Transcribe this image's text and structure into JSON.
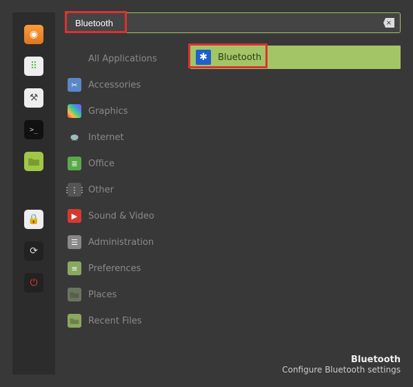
{
  "search": {
    "value": "Bluetooth"
  },
  "favorites": [
    {
      "id": "firefox",
      "glyph": "◉"
    },
    {
      "id": "apps",
      "glyph": "⠿"
    },
    {
      "id": "settings",
      "glyph": "⚒"
    },
    {
      "id": "terminal",
      "glyph": ">_"
    },
    {
      "id": "files",
      "glyph": ""
    },
    {
      "id": "lock",
      "glyph": "🔒"
    },
    {
      "id": "update",
      "glyph": "⟳"
    },
    {
      "id": "power",
      "glyph": "⏻"
    }
  ],
  "categories": [
    {
      "id": "all",
      "label": "All Applications"
    },
    {
      "id": "accessories",
      "label": "Accessories",
      "glyph": "✂"
    },
    {
      "id": "graphics",
      "label": "Graphics",
      "glyph": ""
    },
    {
      "id": "internet",
      "label": "Internet",
      "glyph": ""
    },
    {
      "id": "office",
      "label": "Office",
      "glyph": "≣"
    },
    {
      "id": "other",
      "label": "Other",
      "glyph": "⋮⋮⋮"
    },
    {
      "id": "sound",
      "label": "Sound & Video",
      "glyph": "▶"
    },
    {
      "id": "admin",
      "label": "Administration",
      "glyph": "☰"
    },
    {
      "id": "prefs",
      "label": "Preferences",
      "glyph": "≡"
    },
    {
      "id": "places",
      "label": "Places",
      "glyph": ""
    },
    {
      "id": "recent",
      "label": "Recent Files",
      "glyph": ""
    }
  ],
  "results": [
    {
      "id": "bluetooth",
      "label": "Bluetooth",
      "glyph": "✱"
    }
  ],
  "footer": {
    "title": "Bluetooth",
    "desc": "Configure Bluetooth settings"
  },
  "clear_glyph": "×"
}
